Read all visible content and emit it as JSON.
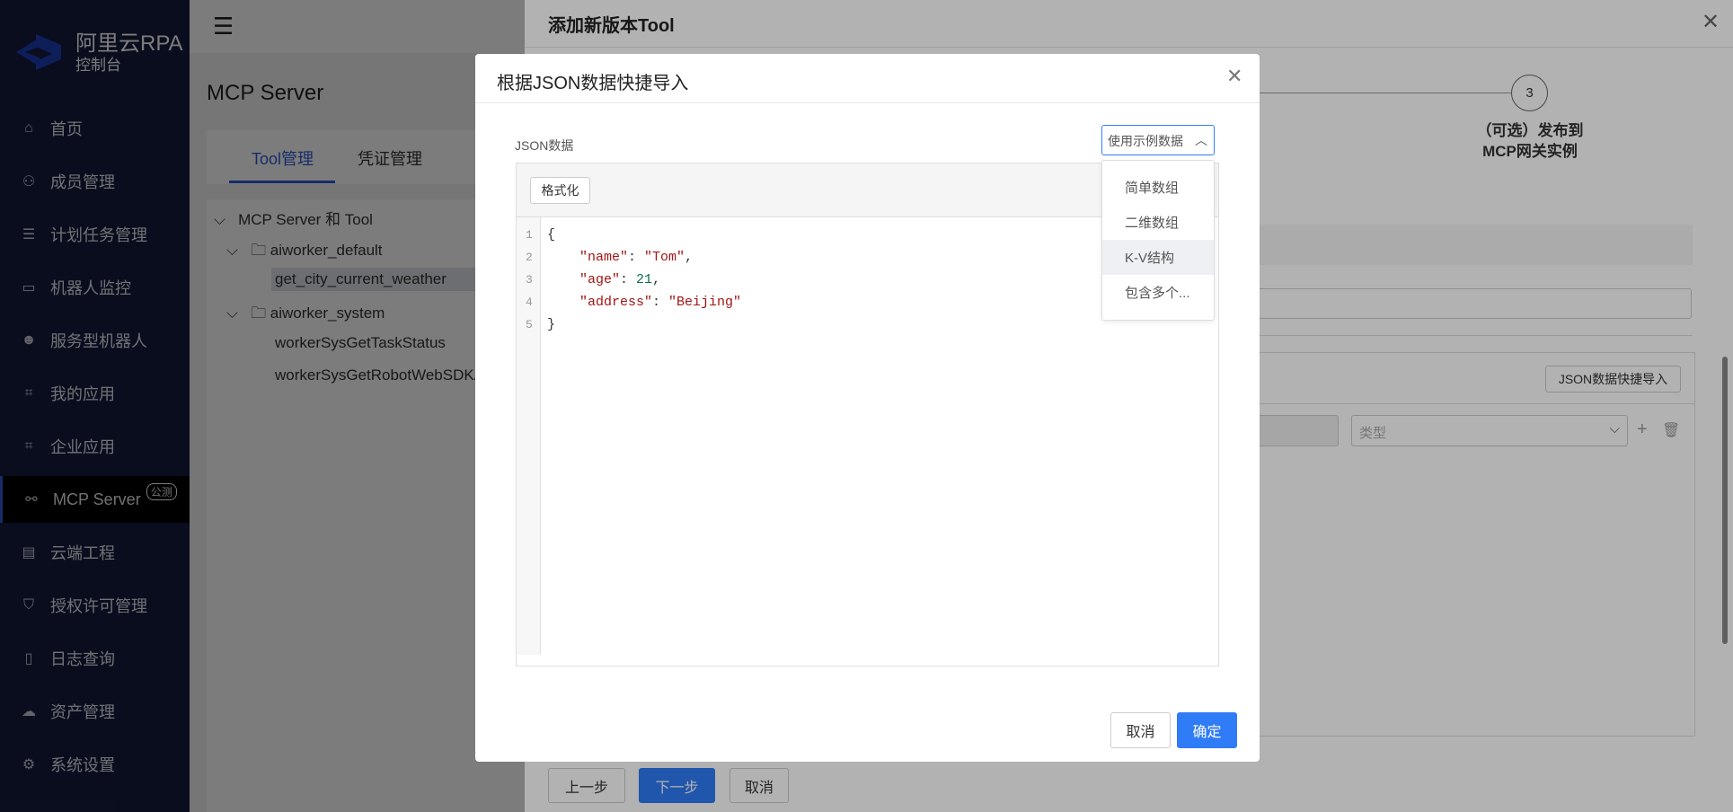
{
  "app": {
    "brand": "阿里云RPA",
    "subtitle": "控制台"
  },
  "sidebar": {
    "items": [
      {
        "label": "首页",
        "icon": "home-icon"
      },
      {
        "label": "成员管理",
        "icon": "user-icon"
      },
      {
        "label": "计划任务管理",
        "icon": "list-icon"
      },
      {
        "label": "机器人监控",
        "icon": "monitor-icon"
      },
      {
        "label": "服务型机器人",
        "icon": "robot-icon"
      },
      {
        "label": "我的应用",
        "icon": "code-icon"
      },
      {
        "label": "企业应用",
        "icon": "code-icon"
      },
      {
        "label": "MCP Server",
        "icon": "link-icon",
        "badge": "公测",
        "active": true
      },
      {
        "label": "云端工程",
        "icon": "project-icon"
      },
      {
        "label": "授权许可管理",
        "icon": "shield-icon"
      },
      {
        "label": "日志查询",
        "icon": "log-icon"
      },
      {
        "label": "资产管理",
        "icon": "asset-icon"
      },
      {
        "label": "系统设置",
        "icon": "gear-icon"
      }
    ]
  },
  "page": {
    "title": "MCP Server",
    "tabs": [
      "Tool管理",
      "凭证管理"
    ],
    "tree": {
      "root": "MCP Server 和 Tool",
      "groups": [
        {
          "name": "aiworker_default",
          "tools": [
            "get_city_current_weather"
          ]
        },
        {
          "name": "aiworker_system",
          "tools": [
            "workerSysGetTaskStatus",
            "workerSysGetRobotWebSDKA"
          ]
        }
      ]
    }
  },
  "drawer": {
    "title": "添加新版本Tool",
    "step3_number": "3",
    "step3_line1": "（可选）发布到",
    "step3_line2": "MCP网关实例",
    "json_import_button": "JSON数据快捷导入",
    "type_placeholder": "类型",
    "prev": "上一步",
    "next": "下一步",
    "cancel": "取消"
  },
  "modal": {
    "title": "根据JSON数据快捷导入",
    "json_label": "JSON数据",
    "sample_select": "使用示例数据",
    "format_button": "格式化",
    "sample_options": [
      "简单数组",
      "二维数组",
      "K-V结构",
      "包含多个..."
    ],
    "highlighted_option": "K-V结构",
    "line_numbers": [
      "1",
      "2",
      "3",
      "4",
      "5"
    ],
    "code": {
      "open": "{",
      "k1": "\"name\"",
      "v1": "\"Tom\"",
      "k2": "\"age\"",
      "v2": "21",
      "k3": "\"address\"",
      "v3": "\"Beijing\"",
      "close": "}"
    },
    "cancel": "取消",
    "confirm": "确定"
  }
}
